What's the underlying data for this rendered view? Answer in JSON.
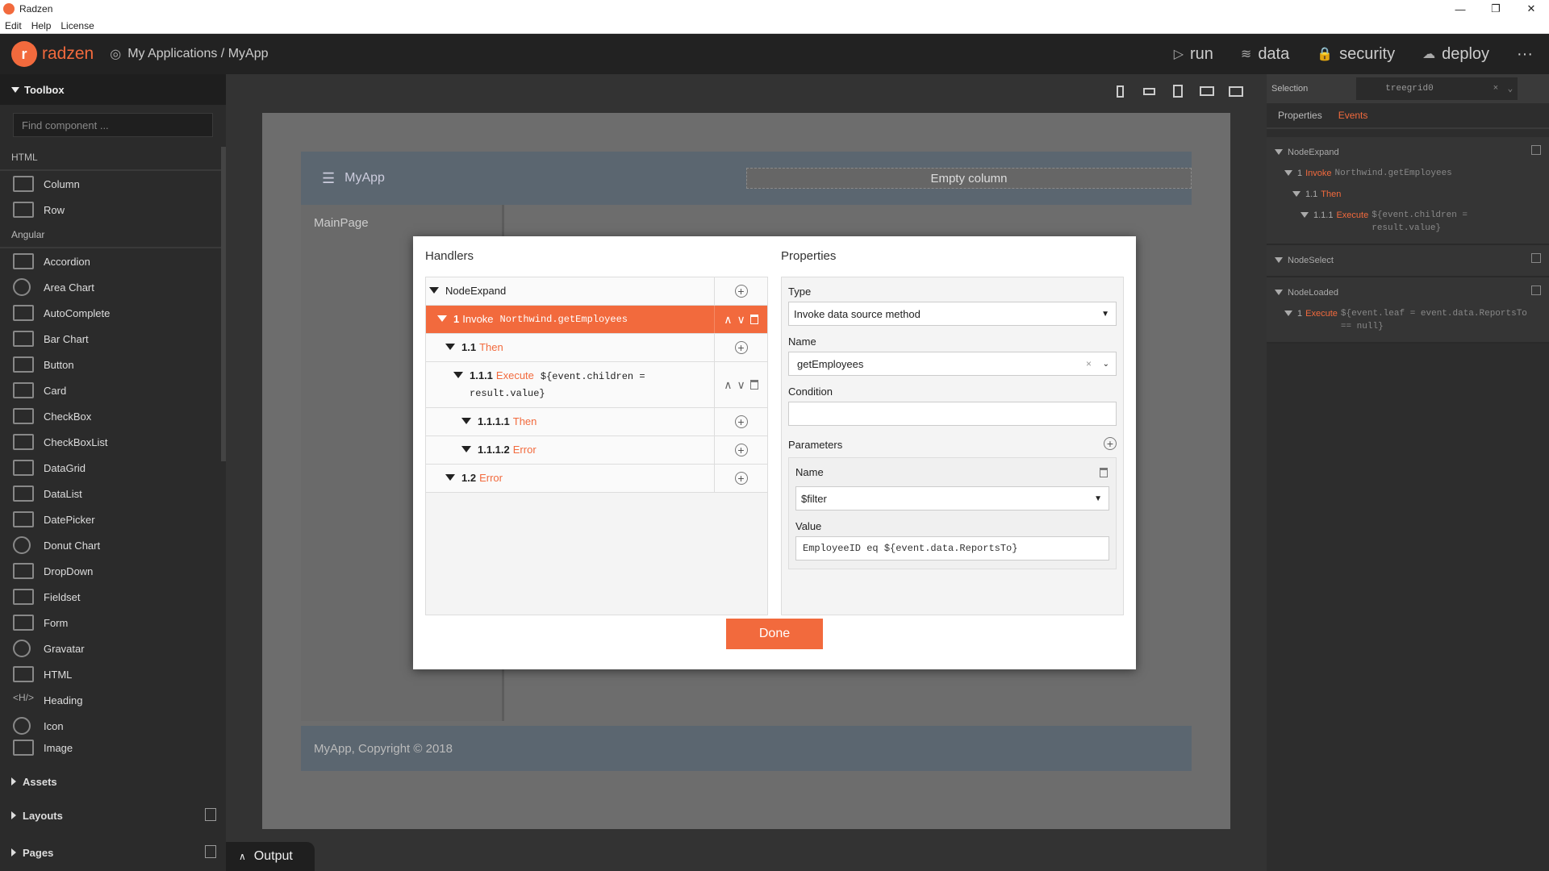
{
  "window": {
    "title": "Radzen",
    "controls": [
      "—",
      "❐",
      "✕"
    ]
  },
  "menu": [
    "Edit",
    "Help",
    "License"
  ],
  "topnav": {
    "logo": "radzen",
    "breadcrumb": "My Applications / MyApp",
    "actions": [
      {
        "label": "run",
        "icon": "▷"
      },
      {
        "label": "data",
        "icon": "≋"
      },
      {
        "label": "security",
        "icon": "🔒"
      },
      {
        "label": "deploy",
        "icon": "☁"
      }
    ],
    "more": "···"
  },
  "toolbox": {
    "title": "Toolbox",
    "search_placeholder": "Find component ...",
    "sections": [
      {
        "name": "HTML",
        "items": [
          "Column",
          "Row"
        ]
      },
      {
        "name": "Angular",
        "items": [
          "Accordion",
          "Area Chart",
          "AutoComplete",
          "Bar Chart",
          "Button",
          "Card",
          "CheckBox",
          "CheckBoxList",
          "DataGrid",
          "DataList",
          "DatePicker",
          "Donut Chart",
          "DropDown",
          "Fieldset",
          "Form",
          "Gravatar",
          "HTML",
          "Heading",
          "Icon",
          "Image"
        ]
      }
    ],
    "bottom": [
      "Assets",
      "Layouts",
      "Pages"
    ]
  },
  "canvas": {
    "app_title": "MyApp",
    "empty_column": "Empty column",
    "main_page": "MainPage",
    "footer": "MyApp, Copyright © 2018"
  },
  "right_panel": {
    "selection_label": "Selection",
    "selection_value": "treegrid0",
    "tabs": [
      "Properties",
      "Events"
    ],
    "events": [
      {
        "name": "NodeExpand",
        "rows": [
          {
            "num": "1",
            "kind": "Invoke",
            "text": "Northwind.getEmployees"
          },
          {
            "num": "1.1",
            "kind": "Then",
            "text": ""
          },
          {
            "num": "1.1.1",
            "kind": "Execute",
            "text": "${event.children = result.value}"
          }
        ]
      },
      {
        "name": "NodeSelect",
        "rows": []
      },
      {
        "name": "NodeLoaded",
        "rows": [
          {
            "num": "1",
            "kind": "Execute",
            "text": "${event.leaf = event.data.ReportsTo == null}"
          }
        ]
      }
    ]
  },
  "modal": {
    "handlers_title": "Handlers",
    "properties_title": "Properties",
    "handlers": [
      {
        "num": "",
        "kind": "",
        "name": "NodeExpand",
        "code": ""
      },
      {
        "num": "1",
        "kind": "Invoke",
        "name": "",
        "code": "Northwind.getEmployees"
      },
      {
        "num": "1.1",
        "kind": "Then",
        "name": "",
        "code": ""
      },
      {
        "num": "1.1.1",
        "kind": "Execute",
        "name": "",
        "code": "${event.children =",
        "code2": "result.value}"
      },
      {
        "num": "1.1.1.1",
        "kind": "Then",
        "name": "",
        "code": ""
      },
      {
        "num": "1.1.1.2",
        "kind": "Error",
        "name": "",
        "code": ""
      },
      {
        "num": "1.2",
        "kind": "Error",
        "name": "",
        "code": ""
      }
    ],
    "props": {
      "type_label": "Type",
      "type_value": "Invoke data source method",
      "name_label": "Name",
      "name_value": "getEmployees",
      "condition_label": "Condition",
      "condition_value": "",
      "parameters_label": "Parameters",
      "param_name_label": "Name",
      "param_name_value": "$filter",
      "param_value_label": "Value",
      "param_value_value": "EmployeeID eq ${event.data.ReportsTo}"
    },
    "done_label": "Done"
  },
  "output_label": "Output"
}
